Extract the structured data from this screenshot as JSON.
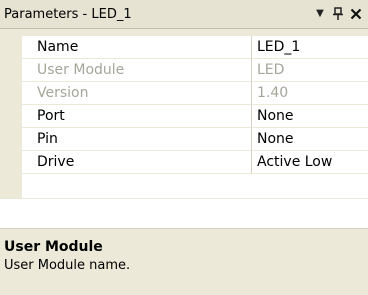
{
  "panel": {
    "title": "Parameters - LED_1",
    "buttons": {
      "dropdown_glyph": "▼",
      "pin_glyph": "ᵖ",
      "close_glyph": "✕"
    }
  },
  "properties": [
    {
      "name": "Name",
      "value": "LED_1",
      "enabled": true
    },
    {
      "name": "User Module",
      "value": "LED",
      "enabled": false
    },
    {
      "name": "Version",
      "value": "1.40",
      "enabled": false
    },
    {
      "name": "Port",
      "value": "None",
      "enabled": true
    },
    {
      "name": "Pin",
      "value": "None",
      "enabled": true
    },
    {
      "name": "Drive",
      "value": "Active Low",
      "enabled": true
    }
  ],
  "description": {
    "title": "User Module",
    "text": "User Module name."
  },
  "colors": {
    "disabled_text": "#a5a59a",
    "panel_bg": "#ece9d8"
  }
}
